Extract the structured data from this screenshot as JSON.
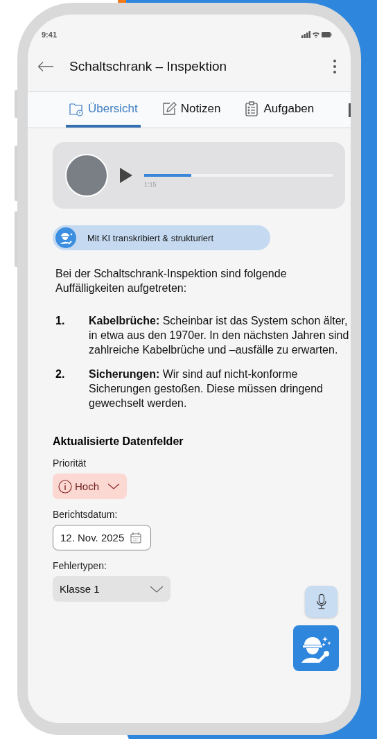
{
  "status_bar": {
    "time": "9:41"
  },
  "header": {
    "title": "Schaltschrank – Inspektion"
  },
  "tabs": [
    {
      "label": "Übersicht",
      "kind": "folder",
      "selected": true
    },
    {
      "label": "Notizen",
      "kind": "edit",
      "selected": false
    },
    {
      "label": "Aufgaben",
      "kind": "clipboard",
      "selected": false
    }
  ],
  "audio": {
    "level": 0.25,
    "time": "1:15"
  },
  "ai_badge": {
    "label": "Mit KI transkribiert & strukturiert"
  },
  "summary": {
    "intro": "Bei der Schaltschrank-Inspektion sind folgende Auffälligkeiten aufgetreten:",
    "items": [
      {
        "number": "1.",
        "text": "**Kabelbrüche:** Scheinbar ist das System schon älter, in etwa aus den 1970er. In den nächsten Jahren sind zahlreiche Kabelbrüche und –ausfälle zu erwarten."
      },
      {
        "number": "2.",
        "text": "**Sicherungen:** Wir sind auf nicht-konforme Sicherungen gestoßen. Diese müssen dringend gewechselt werden."
      }
    ]
  },
  "data_fields": {
    "title": "Aktualisierte Datenfelder",
    "fields": [
      {
        "kind": "priority",
        "label": "Priorität",
        "value": "Hoch"
      },
      {
        "kind": "date",
        "label": "Berichtsdatum:",
        "value": "12. Nov. 2025"
      },
      {
        "kind": "select",
        "label": "Fehlertypen:",
        "value": "Klasse 1"
      }
    ]
  }
}
